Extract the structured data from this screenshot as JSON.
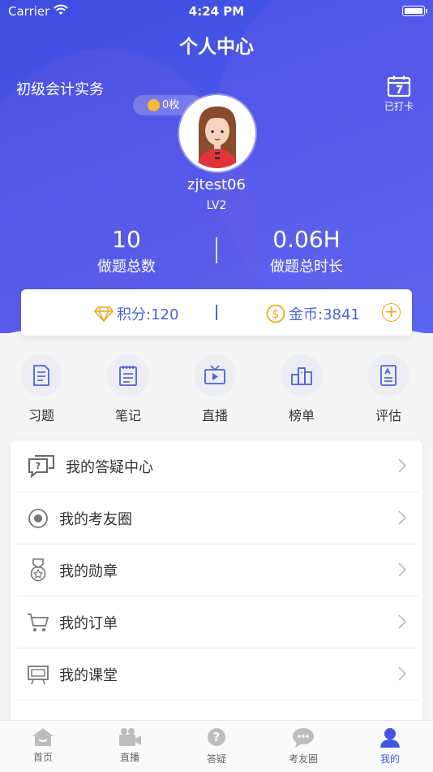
{
  "status_bar": {
    "carrier": "Carrier",
    "time": "4:24 PM"
  },
  "header": {
    "title": "个人中心",
    "course_name": "初级会计实务",
    "checkin_label": "已打卡"
  },
  "profile": {
    "medal_count": "0枚",
    "username": "zjtest06",
    "level": "LV2"
  },
  "stats": {
    "questions_value": "10",
    "questions_label": "做题总数",
    "duration_value": "0.06H",
    "duration_label": "做题总时长"
  },
  "points": {
    "score_label": "积分:120",
    "coins_label": "金币:3841"
  },
  "quick_actions": [
    {
      "label": "习题",
      "icon": "exercise-icon"
    },
    {
      "label": "笔记",
      "icon": "notes-icon"
    },
    {
      "label": "直播",
      "icon": "live-tv-icon"
    },
    {
      "label": "榜单",
      "icon": "ranking-icon"
    },
    {
      "label": "评估",
      "icon": "assessment-icon"
    }
  ],
  "menu": [
    {
      "label": "我的答疑中心",
      "icon": "qa-chat-icon"
    },
    {
      "label": "我的考友圈",
      "icon": "circle-icon"
    },
    {
      "label": "我的勋章",
      "icon": "medal-icon"
    },
    {
      "label": "我的订单",
      "icon": "cart-icon"
    },
    {
      "label": "我的课堂",
      "icon": "classroom-board-icon"
    }
  ],
  "tabbar": [
    {
      "label": "首页",
      "icon": "home-icon"
    },
    {
      "label": "直播",
      "icon": "video-camera-icon"
    },
    {
      "label": "答疑",
      "icon": "question-icon"
    },
    {
      "label": "考友圈",
      "icon": "chat-bubble-icon"
    },
    {
      "label": "我的",
      "icon": "person-icon",
      "active": true
    }
  ],
  "colors": {
    "accent": "#4056e0",
    "points_blue": "#4b63d8",
    "coin_orange": "#f0a51b",
    "hero_start": "#3d4de0"
  }
}
